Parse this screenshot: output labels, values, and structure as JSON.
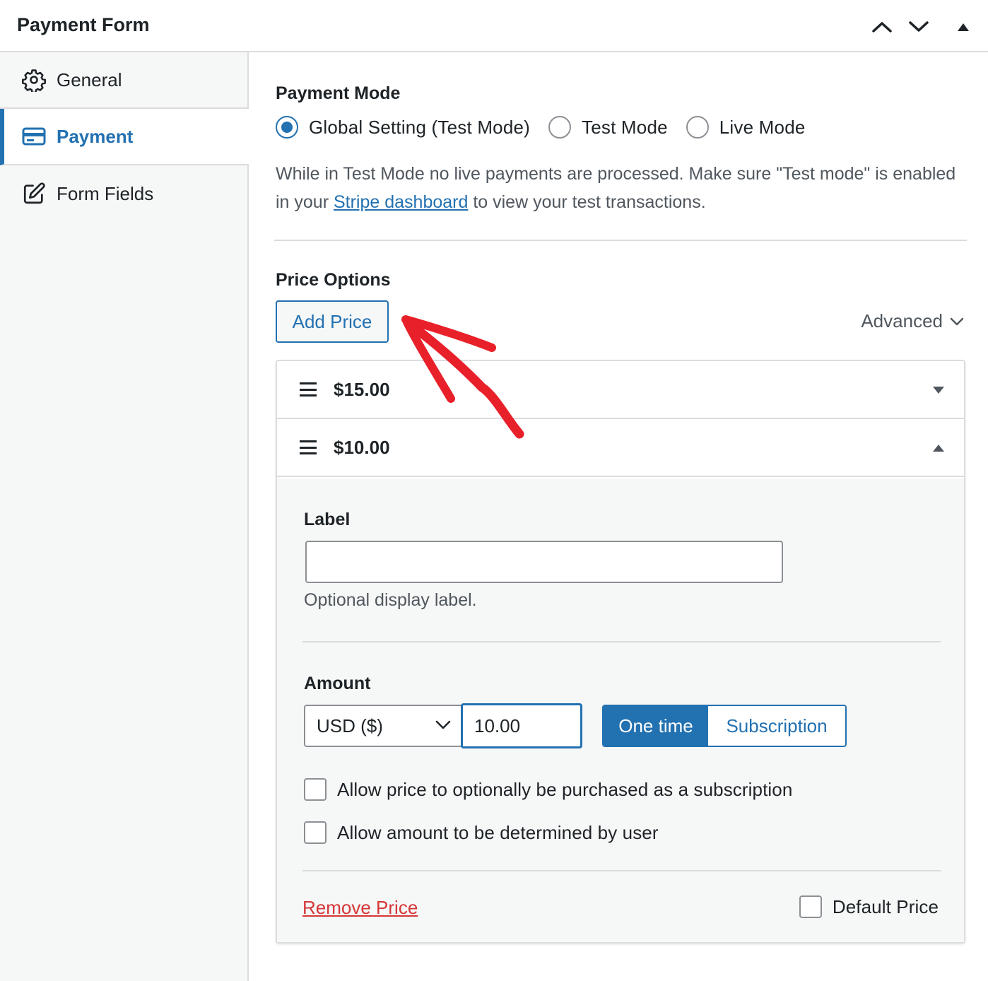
{
  "header": {
    "title": "Payment Form",
    "controls": [
      "move-up",
      "move-down",
      "toggle-panel"
    ]
  },
  "sidebar": {
    "items": [
      {
        "label": "General",
        "icon": "gear-icon",
        "active": false
      },
      {
        "label": "Payment",
        "icon": "credit-card-icon",
        "active": true
      },
      {
        "label": "Form Fields",
        "icon": "edit-icon",
        "active": false
      }
    ]
  },
  "payment_mode": {
    "title": "Payment Mode",
    "options": [
      {
        "label": "Global Setting (Test Mode)",
        "checked": true
      },
      {
        "label": "Test Mode",
        "checked": false
      },
      {
        "label": "Live Mode",
        "checked": false
      }
    ],
    "help_before": "While in Test Mode no live payments are processed. Make sure \"Test mode\" is enabled in your ",
    "help_link": "Stripe dashboard",
    "help_after": " to view your test transactions."
  },
  "price_options": {
    "title": "Price Options",
    "add_button": "Add Price",
    "advanced_label": "Advanced",
    "prices": [
      {
        "amount": "$15.00",
        "expanded": false
      },
      {
        "amount": "$10.00",
        "expanded": true
      }
    ],
    "expanded_price": {
      "label_title": "Label",
      "label_value": "",
      "label_desc": "Optional display label.",
      "amount_title": "Amount",
      "currency": "USD ($)",
      "amount_value": "10.00",
      "type_one_time": "One time",
      "type_subscription": "Subscription",
      "type_selected": "One time",
      "checkbox_subscription": "Allow price to optionally be purchased as a subscription",
      "checkbox_user_amount": "Allow amount to be determined by user",
      "remove_label": "Remove Price",
      "default_label": "Default Price"
    }
  },
  "colors": {
    "accent": "#2271b1",
    "danger": "#d63638",
    "annotation_arrow": "#e8202a"
  }
}
